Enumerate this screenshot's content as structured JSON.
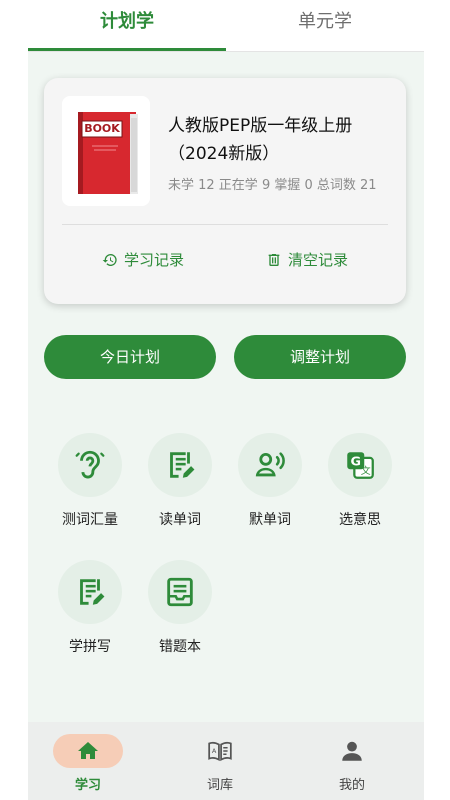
{
  "tabs": [
    {
      "label": "计划学",
      "active": true
    },
    {
      "label": "单元学",
      "active": false
    }
  ],
  "book": {
    "cover_text": "BOOK",
    "title": "人教版PEP版一年级上册（2024新版）",
    "stats": "未学 12  正在学 9  掌握 0  总词数 21",
    "actions": {
      "history": "学习记录",
      "clear": "清空记录"
    }
  },
  "plan": {
    "today": "今日计划",
    "adjust": "调整计划"
  },
  "features": [
    {
      "label": "测词汇量",
      "icon": "ear-icon"
    },
    {
      "label": "读单词",
      "icon": "read-document-icon"
    },
    {
      "label": "默单词",
      "icon": "speak-person-icon"
    },
    {
      "label": "选意思",
      "icon": "translate-icon"
    },
    {
      "label": "学拼写",
      "icon": "spelling-edit-icon"
    },
    {
      "label": "错题本",
      "icon": "notebook-icon"
    }
  ],
  "nav": [
    {
      "label": "学习",
      "icon": "home-icon",
      "active": true
    },
    {
      "label": "词库",
      "icon": "dictionary-icon",
      "active": false
    },
    {
      "label": "我的",
      "icon": "person-icon",
      "active": false
    }
  ],
  "colors": {
    "accent": "#2e8b3a",
    "background": "#f0f6f2",
    "book_red": "#d7282f",
    "nav_pill": "#f6cdb7"
  }
}
